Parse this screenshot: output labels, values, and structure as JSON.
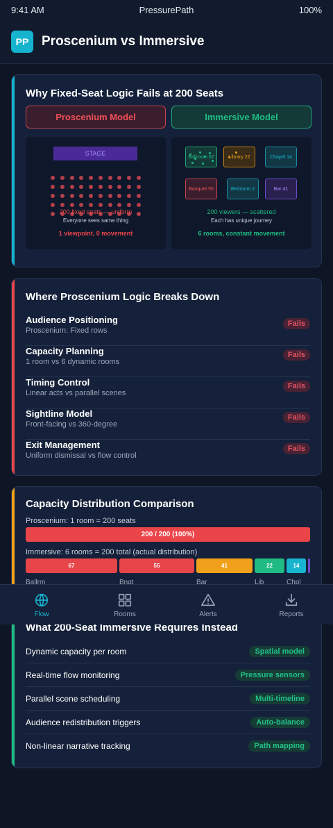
{
  "status": {
    "time": "9:41 AM",
    "app": "PressurePath",
    "battery": "100%"
  },
  "header": {
    "logo": "PP",
    "title": "Proscenium vs Immersive"
  },
  "why_card": {
    "title": "Why Fixed-Seat Logic Fails at 200 Seats",
    "proscenium_label": "Proscenium Model",
    "immersive_label": "Immersive Model",
    "proscenium": {
      "stage": "STAGE",
      "caption": "200 fixed seats — uniform",
      "subcaption": "Everyone sees same thing",
      "summary": "1 viewpoint, 0 movement"
    },
    "immersive": {
      "rooms": [
        "Ballroom 67",
        "Library 22",
        "Chapel 14",
        "Banquet 55",
        "Bedroom 2",
        "Bar 41"
      ],
      "caption": "200 viewers — scattered",
      "subcaption": "Each has unique journey",
      "summary": "6 rooms, constant movement"
    }
  },
  "breakdown_card": {
    "title": "Where Proscenium Logic Breaks Down",
    "rows": [
      {
        "title": "Audience Positioning",
        "subtitle": "Proscenium: Fixed rows",
        "badge": "Fails"
      },
      {
        "title": "Capacity Planning",
        "subtitle": "1 room vs 6 dynamic rooms",
        "badge": "Fails"
      },
      {
        "title": "Timing Control",
        "subtitle": "Linear acts vs parallel scenes",
        "badge": "Fails"
      },
      {
        "title": "Sightline Model",
        "subtitle": "Front-facing vs 360-degree",
        "badge": "Fails"
      },
      {
        "title": "Exit Management",
        "subtitle": "Uniform dismissal vs flow control",
        "badge": "Fails"
      }
    ]
  },
  "capacity_card": {
    "title": "Capacity Distribution Comparison",
    "proscenium_label": "Proscenium: 1 room = 200 seats",
    "proscenium_bar": "200 / 200 (100%)",
    "immersive_label": "Immersive: 6 rooms = 200 total (actual distribution)",
    "segments": [
      {
        "value": "67",
        "label": "Ballrm",
        "color": "#e8454a"
      },
      {
        "value": "55",
        "label": "Bnqt",
        "color": "#e8454a"
      },
      {
        "value": "41",
        "label": "Bar",
        "color": "#f0a01a"
      },
      {
        "value": "22",
        "label": "Lib",
        "color": "#1fbb82"
      },
      {
        "value": "14",
        "label": "Chpl",
        "color": "#18b4d0"
      }
    ]
  },
  "requires_card": {
    "title": "What 200-Seat Immersive Requires Instead",
    "rows": [
      {
        "text": "Dynamic capacity per room",
        "badge": "Spatial model"
      },
      {
        "text": "Real-time flow monitoring",
        "badge": "Pressure sensors"
      },
      {
        "text": "Parallel scene scheduling",
        "badge": "Multi-timeline"
      },
      {
        "text": "Audience redistribution triggers",
        "badge": "Auto-balance"
      },
      {
        "text": "Non-linear narrative tracking",
        "badge": "Path mapping"
      }
    ]
  },
  "nav": {
    "items": [
      {
        "label": "Flow",
        "icon": "globe-icon"
      },
      {
        "label": "Rooms",
        "icon": "grid-icon"
      },
      {
        "label": "Alerts",
        "icon": "warning-icon"
      },
      {
        "label": "Reports",
        "icon": "download-icon"
      }
    ]
  },
  "colors": {
    "accent": "#16b3cf",
    "fail": "#e8454a",
    "success": "#1fbb82",
    "warning": "#f0a01a"
  }
}
